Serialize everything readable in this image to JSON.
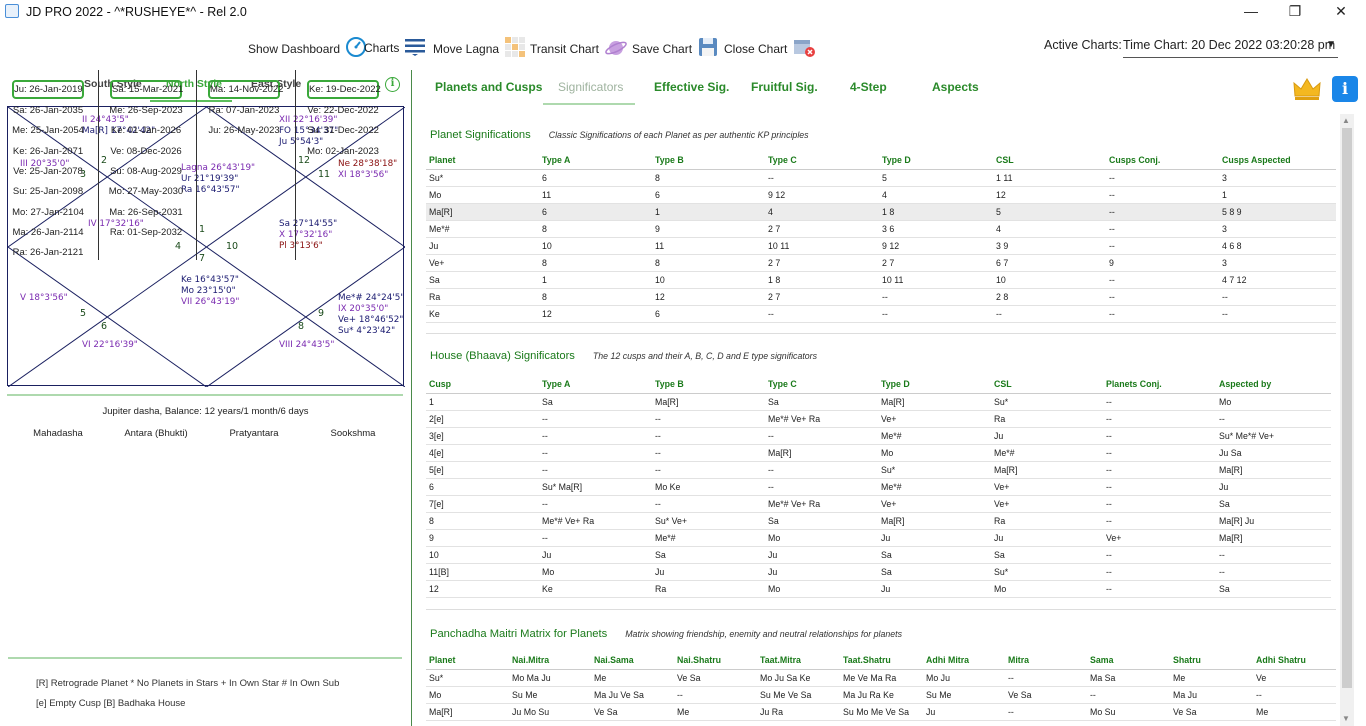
{
  "window": {
    "title": "JD PRO 2022 - ^*RUSHEYE*^  - Rel 2.0",
    "minimize": "—",
    "maximize": "❐",
    "close": "✕"
  },
  "toolbar": {
    "dashboard": "Show Dashboard",
    "charts": "Charts",
    "move_lagna": "Move Lagna",
    "transit": "Transit Chart",
    "save": "Save Chart",
    "close": "Close Chart",
    "active_label": "Active Charts:",
    "active_value": "Time Chart: 20 Dec 2022 03:20:28 pm"
  },
  "styles": {
    "south": "South Style",
    "north": "North Style",
    "east": "East Style",
    "info": "i"
  },
  "chart": {
    "houses": [
      {
        "n": "1",
        "lines": [
          {
            "t": "Lagna  26°43'19\"",
            "c": "cu"
          },
          {
            "t": "Ur 21°19'39\"",
            "c": "pl"
          },
          {
            "t": "Ra 16°43'57\"",
            "c": "pl"
          }
        ]
      },
      {
        "n": "2",
        "lines": [
          {
            "t": "II 24°43'5\"",
            "c": "cu"
          },
          {
            "t": "Ma[R] 17°42'42\"",
            "c": "pl"
          }
        ]
      },
      {
        "n": "3",
        "lines": [
          {
            "t": "III 20°35'0\"",
            "c": "cu"
          }
        ]
      },
      {
        "n": "4",
        "lines": [
          {
            "t": "IV 17°32'16\"",
            "c": "cu"
          }
        ]
      },
      {
        "n": "5",
        "lines": [
          {
            "t": "V 18°3'56\"",
            "c": "cu"
          }
        ]
      },
      {
        "n": "6",
        "lines": [
          {
            "t": "VI 22°16'39\"",
            "c": "cu"
          }
        ]
      },
      {
        "n": "7",
        "lines": [
          {
            "t": "Ke 16°43'57\"",
            "c": "pl"
          },
          {
            "t": "Mo 23°15'0\"",
            "c": "pl"
          },
          {
            "t": "VII 26°43'19\"",
            "c": "cu"
          }
        ]
      },
      {
        "n": "8",
        "lines": [
          {
            "t": "VIII 24°43'5\"",
            "c": "cu"
          }
        ]
      },
      {
        "n": "9",
        "lines": [
          {
            "t": "Me*# 24°24'5\"",
            "c": "pl"
          },
          {
            "t": "IX 20°35'0\"",
            "c": "cu"
          },
          {
            "t": "Ve+ 18°46'52\"",
            "c": "pl"
          },
          {
            "t": "Su* 4°23'42\"",
            "c": "pl"
          }
        ]
      },
      {
        "n": "10",
        "lines": [
          {
            "t": "Sa 27°14'55\"",
            "c": "pl"
          },
          {
            "t": "X 17°32'16\"",
            "c": "cu"
          },
          {
            "t": "Pl 3°13'6\"",
            "c": "pr"
          }
        ]
      },
      {
        "n": "11",
        "lines": [
          {
            "t": "Ne 28°38'18\"",
            "c": "pr"
          },
          {
            "t": "XI 18°3'56\"",
            "c": "cu"
          }
        ]
      },
      {
        "n": "12",
        "lines": [
          {
            "t": "XII 22°16'39\"",
            "c": "cu"
          },
          {
            "t": "FO 15°34'37\"",
            "c": "pl"
          },
          {
            "t": "Ju 5°54'3\"",
            "c": "pl"
          }
        ]
      }
    ]
  },
  "dasha": {
    "info": "Jupiter dasha, Balance: 12 years/1 month/6 days",
    "headers": [
      "Mahadasha",
      "Antara (Bhukti)",
      "Pratyantara",
      "Sookshma"
    ],
    "columns": [
      [
        "Ju: 26-Jan-2019",
        "Sa: 26-Jan-2035",
        "Me: 25-Jan-2054",
        "Ke: 26-Jan-2071",
        "Ve: 25-Jan-2078",
        "Su: 25-Jan-2098",
        "Mo: 27-Jan-2104",
        "Ma: 26-Jan-2114",
        "Ra: 26-Jan-2121"
      ],
      [
        "Sa: 15-Mar-2021",
        "Me: 26-Sep-2023",
        "Ke: 01-Jan-2026",
        "Ve: 08-Dec-2026",
        "Su: 08-Aug-2029",
        "Mo: 27-May-2030",
        "Ma: 26-Sep-2031",
        "Ra: 01-Sep-2032"
      ],
      [
        "Ma: 14-Nov-2022",
        "Ra: 07-Jan-2023",
        "Ju: 26-May-2023"
      ],
      [
        "Ke: 19-Dec-2022",
        "Ve: 22-Dec-2022",
        "Su: 31-Dec-2022",
        "Mo: 02-Jan-2023"
      ]
    ]
  },
  "legend": {
    "line1": "[R]   Retrograde Planet     *    No Planets in Stars     +    In Own Star    #    In Own Sub",
    "line2": "[e]   Empty Cusp    [B]   Badhaka House"
  },
  "tabs": [
    "Planets and Cusps",
    "Significators",
    "Effective Sig.",
    "Fruitful Sig.",
    "4-Step",
    "Aspects"
  ],
  "sec1": {
    "title": "Planet Significations",
    "subtitle": "Classic Significations of each Planet as per authentic KP principles",
    "headers": [
      "Planet",
      "Type A",
      "Type B",
      "Type C",
      "Type D",
      "CSL",
      "Cusps Conj.",
      "Cusps Aspected"
    ],
    "rows": [
      [
        "Su*",
        "6",
        "8",
        "--",
        "5",
        "1  11",
        "--",
        "3"
      ],
      [
        "Mo",
        "11",
        "6",
        "9  12",
        "4",
        "12",
        "--",
        "1"
      ],
      [
        "Ma[R]",
        "6",
        "1",
        "4",
        "1  8",
        "5",
        "--",
        "5  8  9"
      ],
      [
        "Me*#",
        "8",
        "9",
        "2  7",
        "3  6",
        "4",
        "--",
        "3"
      ],
      [
        "Ju",
        "10",
        "11",
        "10  11",
        "9  12",
        "3  9",
        "--",
        "4  6  8"
      ],
      [
        "Ve+",
        "8",
        "8",
        "2  7",
        "2  7",
        "6  7",
        "9",
        "3"
      ],
      [
        "Sa",
        "1",
        "10",
        "1  8",
        "10  11",
        "10",
        "--",
        "4  7  12"
      ],
      [
        "Ra",
        "8",
        "12",
        "2  7",
        "--",
        "2  8",
        "--",
        "--"
      ],
      [
        "Ke",
        "12",
        "6",
        "--",
        "--",
        "--",
        "--",
        "--"
      ]
    ]
  },
  "sec2": {
    "title": "House (Bhaava) Significators",
    "subtitle": "The 12 cusps and their A, B, C, D and E type significators",
    "headers": [
      "Cusp",
      "Type A",
      "Type B",
      "Type C",
      "Type D",
      "CSL",
      "Planets Conj.",
      "Aspected by"
    ],
    "rows": [
      [
        "1",
        "Sa",
        "Ma[R]",
        "Sa",
        "Ma[R]",
        "Su*",
        "--",
        "Mo"
      ],
      [
        "2[e]",
        "--",
        "--",
        "Me*#  Ve+  Ra",
        "Ve+",
        "Ra",
        "--",
        "--"
      ],
      [
        "3[e]",
        "--",
        "--",
        "--",
        "Me*#",
        "Ju",
        "--",
        "Su*  Me*#  Ve+"
      ],
      [
        "4[e]",
        "--",
        "--",
        "Ma[R]",
        "Mo",
        "Me*#",
        "--",
        "Ju  Sa"
      ],
      [
        "5[e]",
        "--",
        "--",
        "--",
        "Su*",
        "Ma[R]",
        "--",
        "Ma[R]"
      ],
      [
        "6",
        "Su*  Ma[R]",
        "Mo  Ke",
        "--",
        "Me*#",
        "Ve+",
        "--",
        "Ju"
      ],
      [
        "7[e]",
        "--",
        "--",
        "Me*#  Ve+  Ra",
        "Ve+",
        "Ve+",
        "--",
        "Sa"
      ],
      [
        "8",
        "Me*#  Ve+  Ra",
        "Su*  Ve+",
        "Sa",
        "Ma[R]",
        "Ra",
        "--",
        "Ma[R]  Ju"
      ],
      [
        "9",
        "--",
        "Me*#",
        "Mo",
        "Ju",
        "Ju",
        "Ve+",
        "Ma[R]"
      ],
      [
        "10",
        "Ju",
        "Sa",
        "Ju",
        "Sa",
        "Sa",
        "--",
        "--"
      ],
      [
        "11[B]",
        "Mo",
        "Ju",
        "Ju",
        "Sa",
        "Su*",
        "--",
        "--"
      ],
      [
        "12",
        "Ke",
        "Ra",
        "Mo",
        "Ju",
        "Mo",
        "--",
        "Sa"
      ]
    ]
  },
  "sec3": {
    "title": "Panchadha Maitri Matrix for Planets",
    "subtitle": "Matrix showing friendship, enemity and neutral relationships for planets",
    "headers": [
      "Planet",
      "Nai.Mitra",
      "Nai.Sama",
      "Nai.Shatru",
      "Taat.Mitra",
      "Taat.Shatru",
      "Adhi Mitra",
      "Mitra",
      "Sama",
      "Shatru",
      "Adhi Shatru"
    ],
    "rows": [
      [
        "Su*",
        "Mo  Ma  Ju",
        "Me",
        "Ve  Sa",
        "Mo  Ju  Sa  Ke",
        "Me  Ve  Ma  Ra",
        "Mo  Ju",
        "--",
        "Ma  Sa",
        "Me",
        "Ve"
      ],
      [
        "Mo",
        "Su  Me",
        "Ma  Ju  Ve  Sa",
        "--",
        "Su  Me  Ve  Sa",
        "Ma  Ju  Ra  Ke",
        "Su  Me",
        "Ve  Sa",
        "--",
        "Ma  Ju",
        "--"
      ],
      [
        "Ma[R]",
        "Ju  Mo  Su",
        "Ve  Sa",
        "Me",
        "Ju  Ra",
        "Su  Mo  Me  Ve  Sa",
        "Ju",
        "--",
        "Mo  Su",
        "Ve  Sa",
        "Me"
      ]
    ]
  }
}
